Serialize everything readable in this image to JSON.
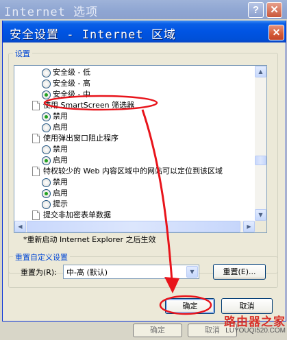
{
  "outer_window": {
    "title": "Internet 选项",
    "help_glyph": "?",
    "close_glyph": "✕",
    "buttons": [
      "确定",
      "取消"
    ]
  },
  "dialog": {
    "title": "安全设置 - Internet 区域",
    "close_glyph": "✕"
  },
  "settings_group": {
    "label": "设置",
    "items": [
      {
        "type": "radio",
        "label": "安全级 - 低",
        "checked": false,
        "indent": 2
      },
      {
        "type": "radio",
        "label": "安全级 - 高",
        "checked": false,
        "indent": 2
      },
      {
        "type": "radio",
        "label": "安全级 - 中",
        "checked": true,
        "indent": 2
      },
      {
        "type": "header",
        "label": "使用 SmartScreen 筛选器",
        "indent": 1
      },
      {
        "type": "radio",
        "label": "禁用",
        "checked": true,
        "indent": 2
      },
      {
        "type": "radio",
        "label": "启用",
        "checked": false,
        "indent": 2
      },
      {
        "type": "header",
        "label": "使用弹出窗口阻止程序",
        "indent": 1
      },
      {
        "type": "radio",
        "label": "禁用",
        "checked": false,
        "indent": 2
      },
      {
        "type": "radio",
        "label": "启用",
        "checked": true,
        "indent": 2
      },
      {
        "type": "header",
        "label": "特权较少的 Web 内容区域中的网站可以定位到该区域",
        "indent": 1
      },
      {
        "type": "radio",
        "label": "禁用",
        "checked": false,
        "indent": 2
      },
      {
        "type": "radio",
        "label": "启用",
        "checked": true,
        "indent": 2
      },
      {
        "type": "radio",
        "label": "提示",
        "checked": false,
        "indent": 2
      },
      {
        "type": "header",
        "label": "提交非加密表单数据",
        "indent": 1
      }
    ],
    "restart_note": "*重新启动 Internet Explorer 之后生效"
  },
  "reset_group": {
    "label": "重置自定义设置",
    "reset_to_label": "重置为(R):",
    "selected_level": "中-高 (默认)",
    "reset_button": "重置(E)..."
  },
  "footer": {
    "ok_button": "确定",
    "cancel_button": "取消"
  },
  "watermark": {
    "logo_text": "路由器之家",
    "url": "LUYOUQI520.COM"
  },
  "colors": {
    "annotation_red": "#E8141B",
    "titlebar_blue": "#0054E3",
    "group_label_blue": "#0046D5"
  }
}
